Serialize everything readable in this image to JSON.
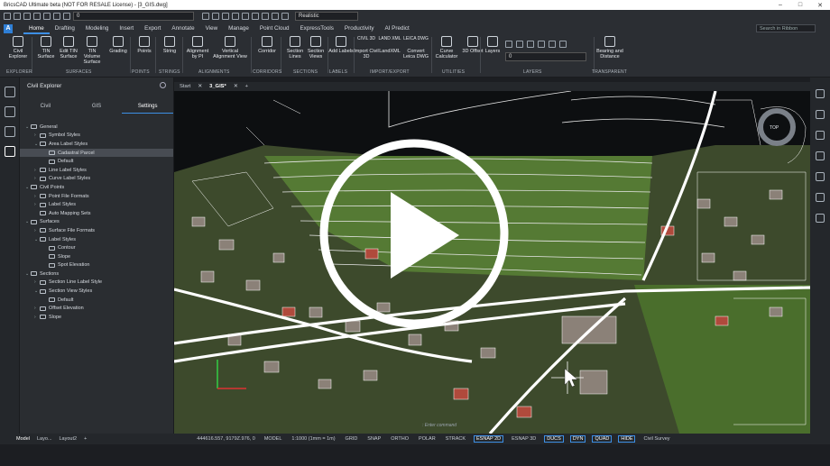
{
  "title_bar": {
    "title": "BricsCAD Ultimate beta (NOT FOR RESALE License) - [3_GIS.dwg]"
  },
  "quick_access": {
    "layer_value": "0",
    "visual_style": "Realistic"
  },
  "ribbon_tabs": [
    "Home",
    "Drafting",
    "Modeling",
    "Insert",
    "Export",
    "Annotate",
    "View",
    "Manage",
    "Point Cloud",
    "ExpressTools",
    "Productivity",
    "AI Predict"
  ],
  "search_placeholder": "Search in Ribbon",
  "ribbon": {
    "buttons": [
      "Civil Explorer",
      "TIN Surface",
      "Edit TIN Surface",
      "TIN Volume Surface",
      "Grading",
      "Points",
      "String",
      "Alignment by PI",
      "Vertical Alignment View",
      "Corridor",
      "Section Lines",
      "Section Views",
      "Add Labels",
      "Import Civil 3D",
      "LandXML",
      "Convert Leica DWG",
      "Curve Calculator",
      "3D Offset",
      "Layers",
      "Bearing and Distance"
    ],
    "groups": [
      "EXPLORER",
      "SURFACES",
      "POINTS",
      "STRINGS",
      "ALIGNMENTS",
      "CORRIDORS",
      "SECTIONS",
      "LABELS",
      "IMPORT/EXPORT",
      "UTILITIES",
      "LAYERS",
      "TRANSPARENT"
    ],
    "small_labels": {
      "civil3d": "CIVIL 3D",
      "landxml": "LAND XML",
      "leica": "LEICA DWG"
    }
  },
  "explorer": {
    "title": "Civil Explorer",
    "tabs": [
      "Civil",
      "GIS",
      "Settings"
    ],
    "active_tab": "Settings",
    "tree": [
      {
        "label": "General",
        "level": 0,
        "expanded": true
      },
      {
        "label": "Symbol Styles",
        "level": 1,
        "expanded": false
      },
      {
        "label": "Area Label Styles",
        "level": 1,
        "expanded": true
      },
      {
        "label": "Cadastral Parcel",
        "level": 2,
        "selected": true
      },
      {
        "label": "Default",
        "level": 2
      },
      {
        "label": "Line Label Styles",
        "level": 1,
        "expanded": false
      },
      {
        "label": "Curve Label Styles",
        "level": 1,
        "expanded": false
      },
      {
        "label": "Civil Points",
        "level": 0,
        "expanded": true
      },
      {
        "label": "Point File Formats",
        "level": 1,
        "expanded": false
      },
      {
        "label": "Label Styles",
        "level": 1,
        "expanded": false
      },
      {
        "label": "Auto Mapping Sets",
        "level": 1
      },
      {
        "label": "Surfaces",
        "level": 0,
        "expanded": true
      },
      {
        "label": "Surface File Formats",
        "level": 1,
        "expanded": false
      },
      {
        "label": "Label Styles",
        "level": 1,
        "expanded": true
      },
      {
        "label": "Contour",
        "level": 2
      },
      {
        "label": "Slope",
        "level": 2
      },
      {
        "label": "Spot Elevation",
        "level": 2
      },
      {
        "label": "Sections",
        "level": 0,
        "expanded": true
      },
      {
        "label": "Section Line Label Style",
        "level": 1,
        "expanded": false
      },
      {
        "label": "Section View Styles",
        "level": 1,
        "expanded": true
      },
      {
        "label": "Default",
        "level": 2
      },
      {
        "label": "Offset Elevation",
        "level": 1,
        "expanded": false
      },
      {
        "label": "Slope",
        "level": 1,
        "expanded": false
      }
    ]
  },
  "drawing_tabs": [
    "Start",
    "3_GIS*"
  ],
  "drawing_active": "3_GIS*",
  "viewport": {
    "compass_label": "TOP",
    "command_prompt": ": Enter command"
  },
  "status": {
    "layout_tabs": [
      "Model",
      "Layo...",
      "Layout2"
    ],
    "coords": "444616.557, 9179Z.976, 0",
    "items": [
      "MODEL",
      "1:1000 (1mm = 1m)",
      "GRID",
      "SNAP",
      "ORTHO",
      "POLAR",
      "STRACK",
      "ESNAP 2D",
      "ESNAP 3D",
      "DUCS",
      "DYN",
      "QUAD",
      "HIDE",
      "Civil Survey"
    ],
    "active_items": [
      "ESNAP 2D",
      "DUCS",
      "DYN",
      "QUAD",
      "HIDE"
    ]
  },
  "colors": {
    "accent": "#3d8fe5",
    "field_green": "#3f6b2e",
    "roof_red": "#b04a3c",
    "road": "#ffffff"
  }
}
